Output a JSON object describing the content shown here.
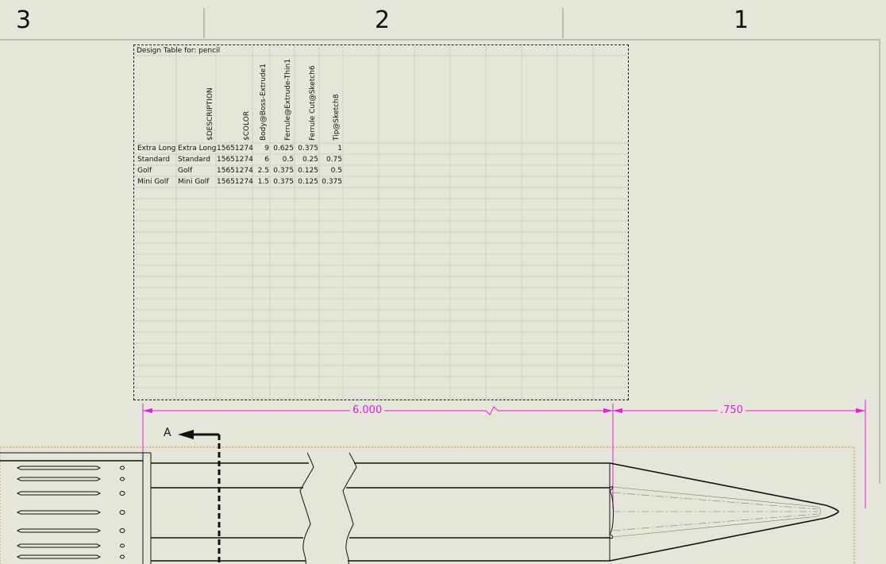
{
  "zones": {
    "labels": [
      "3",
      "2",
      "1"
    ]
  },
  "design_table": {
    "title": "Design Table for: pencil",
    "column_headers": [
      "$DESCRIPTION",
      "$COLOR",
      "Body@Boss-Extrude1",
      "Ferrule@Extrude-Thin1",
      "Ferrule Cut@Sketch6",
      "Tip@Sketch8"
    ],
    "rows": [
      [
        "Extra Long",
        "Extra Long",
        "15651274",
        "9",
        "0.625",
        "0.375",
        "1"
      ],
      [
        "Standard",
        "Standard",
        "15651274",
        "6",
        "0.5",
        "0.25",
        "0.75"
      ],
      [
        "Golf",
        "Golf",
        "15651274",
        "2.5",
        "0.375",
        "0.125",
        "0.5"
      ],
      [
        "Mini Golf",
        "Mini Golf",
        "15651274",
        "1.5",
        "0.375",
        "0.125",
        "0.375"
      ]
    ]
  },
  "dimensions": {
    "body_length": "6.000",
    "tip_length": ".750",
    "color": "#e020e0"
  },
  "section_view": {
    "label": "A"
  }
}
